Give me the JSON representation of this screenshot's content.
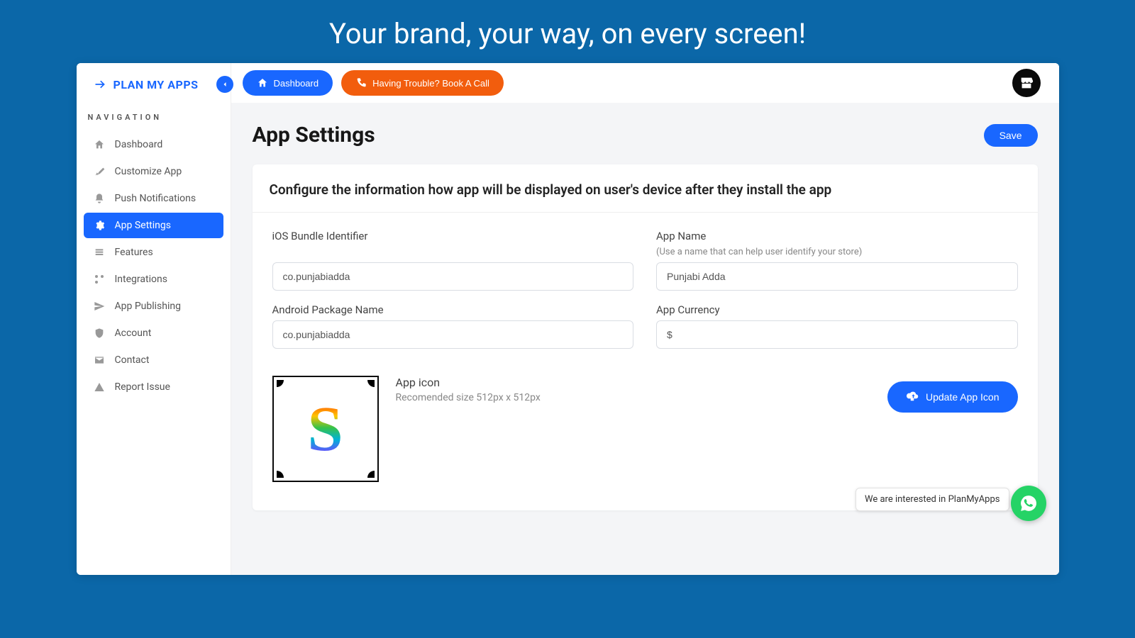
{
  "tagline": "Your brand, your way, on every screen!",
  "brand": "PLAN MY APPS",
  "nav": {
    "heading": "NAVIGATION",
    "items": [
      {
        "label": "Dashboard"
      },
      {
        "label": "Customize App"
      },
      {
        "label": "Push Notifications"
      },
      {
        "label": "App Settings"
      },
      {
        "label": "Features"
      },
      {
        "label": "Integrations"
      },
      {
        "label": "App Publishing"
      },
      {
        "label": "Account"
      },
      {
        "label": "Contact"
      },
      {
        "label": "Report Issue"
      }
    ]
  },
  "topbar": {
    "dashboard": "Dashboard",
    "trouble": "Having Trouble? Book A Call"
  },
  "page": {
    "title": "App Settings",
    "save": "Save"
  },
  "card": {
    "heading": "Configure the information how app will be displayed on user's device after they install the app",
    "ios_label": "iOS Bundle Identifier",
    "ios_value": "co.punjabiadda",
    "android_label": "Android Package Name",
    "android_value": "co.punjabiadda",
    "appname_label": "App Name",
    "appname_hint": "(Use a name that can help user identify your store)",
    "appname_value": "Punjabi Adda",
    "currency_label": "App Currency",
    "currency_value": "$",
    "icon_title": "App icon",
    "icon_hint": "Recomended size 512px x 512px",
    "upload": "Update App Icon"
  },
  "whatsapp_text": "We are interested in PlanMyApps"
}
